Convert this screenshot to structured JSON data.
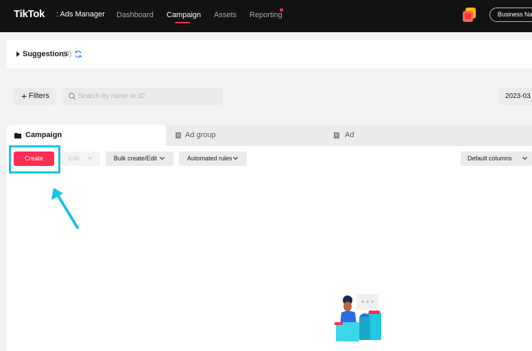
{
  "header": {
    "logo": "TikTok",
    "logo_suffix": ": Ads Manager",
    "nav": [
      {
        "label": "Dashboard",
        "active": false
      },
      {
        "label": "Campaign",
        "active": true
      },
      {
        "label": "Assets",
        "active": false
      },
      {
        "label": "Reporting",
        "active": false,
        "has_dot": true
      }
    ],
    "business_button": "Business Nam"
  },
  "suggestions": {
    "label": "Suggestions",
    "count": "(0)"
  },
  "filters": {
    "filters_label": "Filters",
    "search_placeholder": "Search by name or ID",
    "date": "2023-03"
  },
  "tabs": [
    {
      "label": "Campaign",
      "icon": "folder-icon",
      "active": true
    },
    {
      "label": "Ad group",
      "icon": "document-icon",
      "active": false
    },
    {
      "label": "Ad",
      "icon": "document-icon",
      "active": false
    }
  ],
  "toolbar": {
    "create": "Create",
    "edit": "Edit",
    "bulk": "Bulk create/Edit",
    "automated": "Automated rules",
    "columns": "Default columns"
  },
  "colors": {
    "brand": "#fe2c55",
    "highlight": "#14c3e8",
    "topbar": "#121212"
  }
}
